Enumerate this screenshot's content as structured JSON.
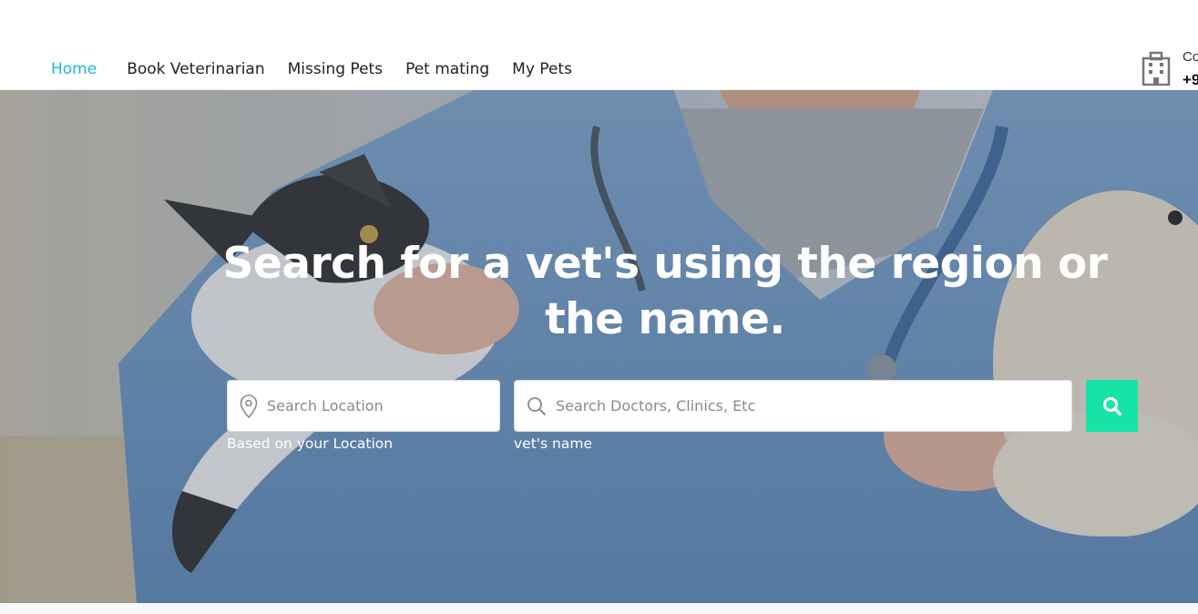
{
  "nav": {
    "items": [
      {
        "label": "Home",
        "active": true
      },
      {
        "label": "Book Veterinarian",
        "active": false
      },
      {
        "label": "Missing Pets",
        "active": false
      },
      {
        "label": "Pet mating",
        "active": false
      },
      {
        "label": "My Pets",
        "active": false
      }
    ]
  },
  "contact": {
    "label": "Co",
    "phone": "+9",
    "icon": "building-icon"
  },
  "hero": {
    "title": "Search for a vet's using the region or the name.",
    "location_search": {
      "placeholder": "Search Location",
      "value": "",
      "icon": "map-pin-icon",
      "hint": "Based on your Location"
    },
    "doctor_search": {
      "placeholder": "Search Doctors, Clinics, Etc",
      "value": "",
      "icon": "search-icon",
      "hint": "vet's name"
    },
    "search_button_icon": "search-icon"
  },
  "colors": {
    "accent": "#1fb6d8",
    "search_button": "#16e3a6",
    "text": "#222222"
  }
}
